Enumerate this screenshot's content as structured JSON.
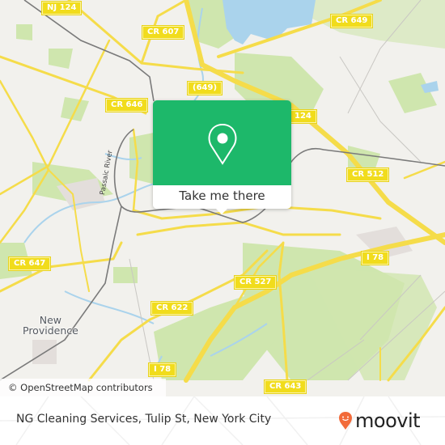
{
  "map": {
    "road_labels": [
      {
        "id": "nj124-top",
        "text": "NJ 124"
      },
      {
        "id": "cr607",
        "text": "CR 607"
      },
      {
        "id": "cr649",
        "text": "CR 649"
      },
      {
        "id": "r649",
        "text": "(649)"
      },
      {
        "id": "cr646",
        "text": "CR 646"
      },
      {
        "id": "nj124-mid",
        "text": "124"
      },
      {
        "id": "cr512",
        "text": "CR 512"
      },
      {
        "id": "cr647",
        "text": "CR 647"
      },
      {
        "id": "i78-east",
        "text": "I 78"
      },
      {
        "id": "cr527",
        "text": "CR 527"
      },
      {
        "id": "cr622",
        "text": "CR 622"
      },
      {
        "id": "i78-south",
        "text": "I 78"
      },
      {
        "id": "cr643",
        "text": "CR 643"
      }
    ],
    "place_labels": {
      "new_providence": "New\nProvidence",
      "passaic_river": "Passaic River"
    },
    "attribution": "© OpenStreetMap contributors",
    "colors": {
      "land": "#f2f1ed",
      "park": "#c9e3a6",
      "water": "#a9d3ec",
      "road": "#f5dc4a",
      "rail": "#7a7a7a"
    }
  },
  "popup": {
    "cta_label": "Take me there",
    "accent": "#1db86a"
  },
  "footer": {
    "title": "NG Cleaning Services, Tulip St, New York City",
    "brand": "moovit",
    "brand_color": "#f26b3a"
  }
}
